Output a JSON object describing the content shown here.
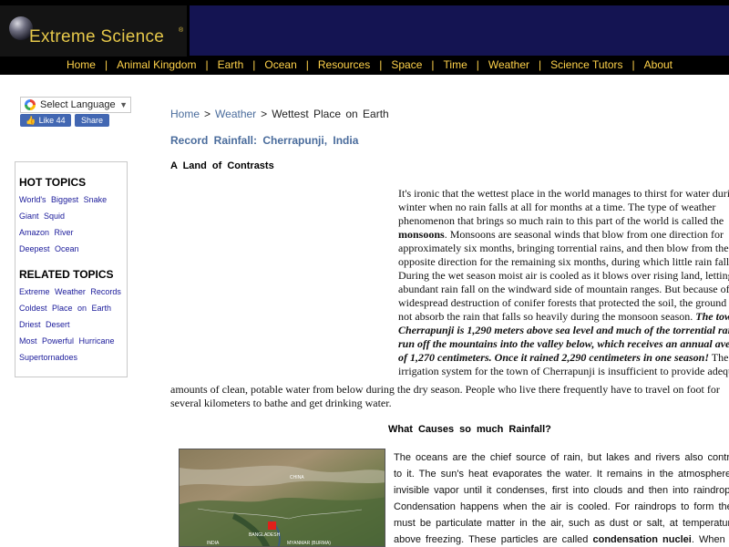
{
  "brand": {
    "name": "Extreme Science",
    "reg_mark": "®"
  },
  "nav": [
    "Home",
    "Animal Kingdom",
    "Earth",
    "Ocean",
    "Resources",
    "Space",
    "Time",
    "Weather",
    "Science Tutors",
    "About"
  ],
  "nav_separator": "|",
  "translate": {
    "label": "Select Language",
    "caret": "▼"
  },
  "social": {
    "like_label": "Like 44",
    "share_label": "Share"
  },
  "sidebar": {
    "hot_heading": "HOT TOPICS",
    "hot_links": [
      "World's Biggest Snake",
      "Giant Squid",
      "Amazon River",
      "Deepest Ocean"
    ],
    "related_heading": "RELATED TOPICS",
    "related_links": [
      "Extreme Weather Records",
      "Coldest Place on Earth",
      "Driest Desert",
      "Most Powerful Hurricane",
      "Supertornadoes"
    ]
  },
  "breadcrumb": {
    "home": "Home",
    "weather": "Weather",
    "sep": ">",
    "current": "Wettest Place on Earth"
  },
  "article": {
    "title": "Record Rainfall: Cherrapunji, India",
    "subheading": "A Land of Contrasts",
    "section_heading": "What Causes so much Rainfall?"
  },
  "paragraph1": {
    "l1": "It's ironic that the wettest place in the world manages to thirst for water during",
    "l2": "winter when no rain falls at all for months at a time. The type of weather",
    "l3": "phenomenon that brings so much rain to this part of the world is called the",
    "l4_bold": "monsoons",
    "l4_rest": ". Monsoons are seasonal winds that blow from one direction for",
    "l5": "approximately six months, bringing torrential rains, and then blow from the",
    "l6": "opposite direction for the remaining six months, during which little rain falls.",
    "l7": "During the wet season moist air is cooled as it blows over rising land, letting",
    "l8": "abundant rain fall on the windward side of mountain ranges. But because of",
    "l9": "widespread destruction of conifer forests that protected the soil, the ground can",
    "l10_plain": "not absorb the rain that falls so heavily during the monsoon season. ",
    "l10_bi": "The town of",
    "l11": "Cherrapunji is 1,290 meters above sea level and much of the torrential rain",
    "l12": "run off the mountains into the valley below, which receives an annual average",
    "l13_bi": "of 1,270 centimeters. Once it rained 2,290 centimeters in one season!",
    "l13_rest": " The",
    "l14": "irrigation system for the town of Cherrapunji is insufficient to provide adequate",
    "l15": "amounts of clean, potable water from below during the dry season. People who live there frequently have to travel on foot for",
    "l16": "several kilometers to bathe and get drinking water."
  },
  "paragraph2": {
    "l1": "The oceans are the chief source of rain, but lakes and rivers also contribute",
    "l2": "to it. The sun's heat evaporates the water. It remains in the atmosphere as",
    "l3": "invisible vapor until it condenses, first into clouds and then into raindrops.",
    "l4": "Condensation happens when the air is cooled. For raindrops to form there",
    "l5": "must be particulate matter in the air, such as dust or salt, at temperatures",
    "l6_plain": "above freezing. These particles are called ",
    "l6_bold": "condensation nuclei",
    "l6_rest": ". When"
  },
  "map": {
    "labels": [
      "CHINA",
      "BANGLADESH",
      "INDIA",
      "MYANMAR (BURMA)"
    ],
    "marker_color": "#e0201a"
  },
  "colors": {
    "header_band": "#141452",
    "nav_text": "#ffd24a",
    "brand_text": "#e6c84a",
    "link_blue": "#4a6c9c",
    "sidebar_link": "#1a1a9a"
  }
}
